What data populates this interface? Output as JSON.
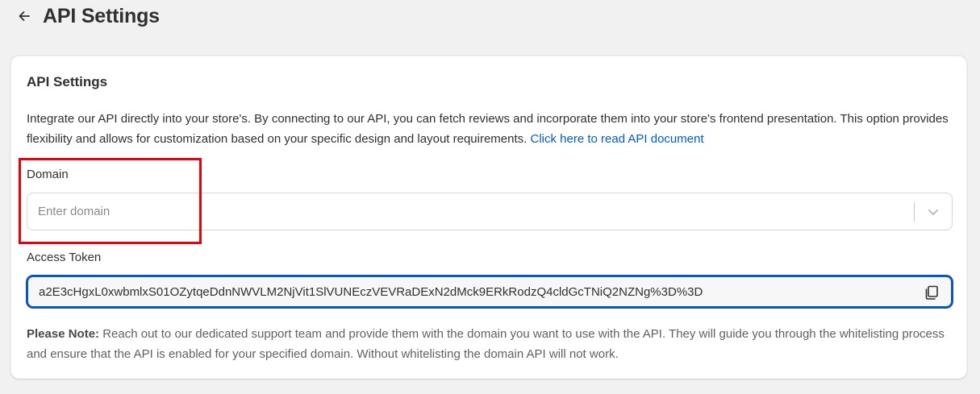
{
  "header": {
    "title": "API Settings",
    "back_icon": "arrow-left-icon"
  },
  "card": {
    "title": "API Settings",
    "description": "Integrate our API directly into your store's. By connecting to our API, you can fetch reviews and incorporate them into your store's frontend presentation. This option provides flexibility and allows for customization based on your specific design and layout requirements. ",
    "doc_link": "Click here to read API document"
  },
  "domain": {
    "label": "Domain",
    "placeholder": "Enter domain",
    "chevron_icon": "chevron-down-icon"
  },
  "access_token": {
    "label": "Access Token",
    "value": "a2E3cHgxL0xwbmlxS01OZytqeDdnNWVLM2NjVit1SlVUNEczVEVRaDExN2dMck9ERkRodzQ4cldGcTNiQ2NZNg%3D%3D",
    "copy_icon": "copy-icon"
  },
  "note": {
    "bold": "Please Note:",
    "text": " Reach out to our dedicated support team and provide them with the domain you want to use with the API. They will guide you through the whitelisting process and ensure that the API is enabled for your specified domain. Without whitelisting the domain API will not work."
  },
  "colors": {
    "link": "#005bd3",
    "highlight": "#e8000b",
    "focus": "#005bd3"
  }
}
